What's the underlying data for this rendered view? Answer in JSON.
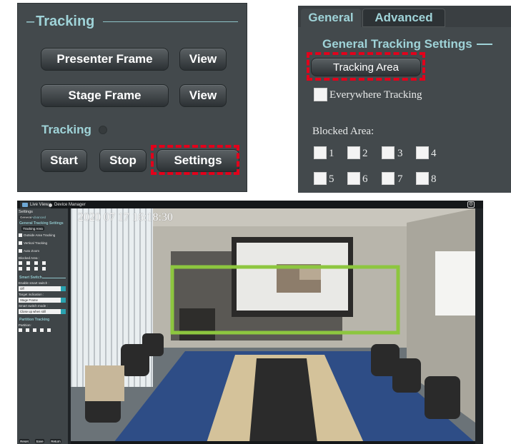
{
  "tracking_panel": {
    "heading": "Tracking",
    "presenter_frame_label": "Presenter Frame",
    "stage_frame_label": "Stage Frame",
    "view_label": "View",
    "status_label": "Tracking",
    "start_label": "Start",
    "stop_label": "Stop",
    "settings_label": "Settings"
  },
  "general_panel": {
    "tabs": [
      {
        "label": "General"
      },
      {
        "label": "Advanced"
      }
    ],
    "heading": "General Tracking Settings",
    "tracking_area_label": "Tracking Area",
    "everywhere_tracking_label": "Everywhere Tracking",
    "blocked_area_label": "Blocked Area:",
    "blocked_areas": [
      "1",
      "2",
      "3",
      "4",
      "5",
      "6",
      "7",
      "8"
    ]
  },
  "app": {
    "tabs": [
      {
        "label": "Live View"
      },
      {
        "label": "Device Manager"
      }
    ],
    "sidebar": {
      "title": "Settings",
      "tabs": [
        "General",
        "Advanced"
      ],
      "heading_general": "General Tracking Settings",
      "tracking_area_label": "Tracking Area",
      "options": [
        "Outside Area Tracking",
        "Vertical Tracking",
        "Auto Zoom"
      ],
      "blocked_area_label": "Blocked Area :",
      "smart_switch_heading": "Smart Switch",
      "enable_smart_switch_label": "Enable smart switch :",
      "enable_smart_switch_value": "Off",
      "target_indication_label": "Target indication :",
      "target_indication_value": "Stage Frame",
      "smart_switch_mode_label": "Smart switch mode :",
      "smart_switch_mode_value": "Close up when still",
      "partition_heading": "Partition Tracking",
      "partition_label": "Partition:",
      "footer_buttons": [
        "Reset",
        "Save",
        "Return"
      ]
    },
    "video": {
      "timestamp": "2020 07 17 16:18:30"
    },
    "colors": {
      "tracking_area_box": "#8dc63f",
      "highlight_dash": "#e3001b",
      "accent_teal": "#9fd3d8"
    }
  }
}
